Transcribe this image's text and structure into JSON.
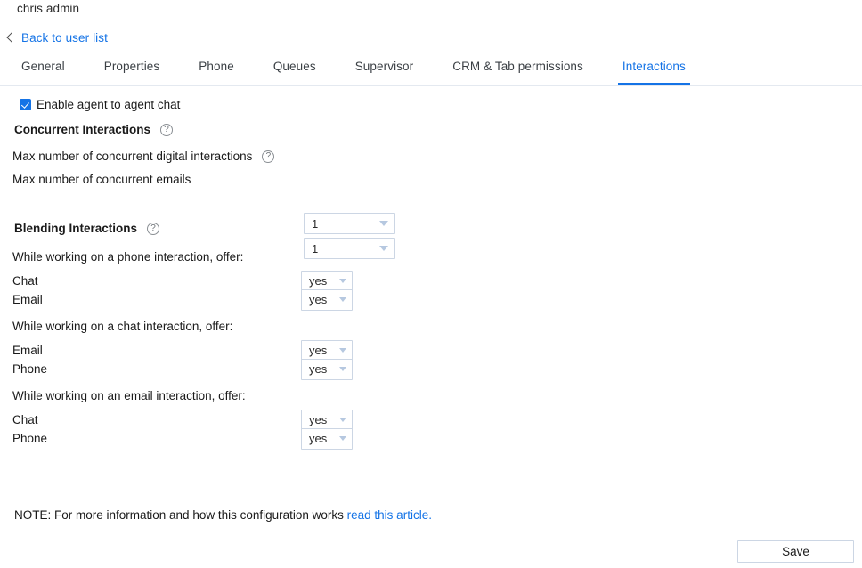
{
  "header": {
    "user_name": "chris admin",
    "back_link": "Back to user list",
    "back_icon": "chevron-left-icon"
  },
  "tabs": [
    {
      "label": "General",
      "active": false
    },
    {
      "label": "Properties",
      "active": false
    },
    {
      "label": "Phone",
      "active": false
    },
    {
      "label": "Queues",
      "active": false
    },
    {
      "label": "Supervisor",
      "active": false
    },
    {
      "label": "CRM & Tab permissions",
      "active": false
    },
    {
      "label": "Interactions",
      "active": true
    }
  ],
  "agent_chat": {
    "label": "Enable agent to agent chat",
    "checked": true
  },
  "concurrent": {
    "title": "Concurrent Interactions",
    "help_icon": "help-circle-icon",
    "rows": [
      {
        "label": "Max number of concurrent digital interactions",
        "has_help": true,
        "value": "1"
      },
      {
        "label": "Max number of concurrent emails",
        "has_help": false,
        "value": "1"
      }
    ]
  },
  "blending": {
    "title": "Blending Interactions",
    "help_icon": "help-circle-icon",
    "groups": [
      {
        "heading": "While working on a phone interaction, offer:",
        "rows": [
          {
            "label": "Chat",
            "value": "yes"
          },
          {
            "label": "Email",
            "value": "yes"
          }
        ]
      },
      {
        "heading": "While working on a chat interaction, offer:",
        "rows": [
          {
            "label": "Email",
            "value": "yes"
          },
          {
            "label": "Phone",
            "value": "yes"
          }
        ]
      },
      {
        "heading": "While working on an email interaction, offer:",
        "rows": [
          {
            "label": "Chat",
            "value": "yes"
          },
          {
            "label": "Phone",
            "value": "yes"
          }
        ]
      }
    ]
  },
  "note": {
    "text": "NOTE: For more information and how this configuration works ",
    "link_text": "read this article."
  },
  "footer": {
    "save_label": "Save"
  },
  "colors": {
    "accent": "#1473e6",
    "border": "#ccd6e4",
    "tab_border": "#e4e9f0",
    "caret": "#b6c8e0"
  }
}
